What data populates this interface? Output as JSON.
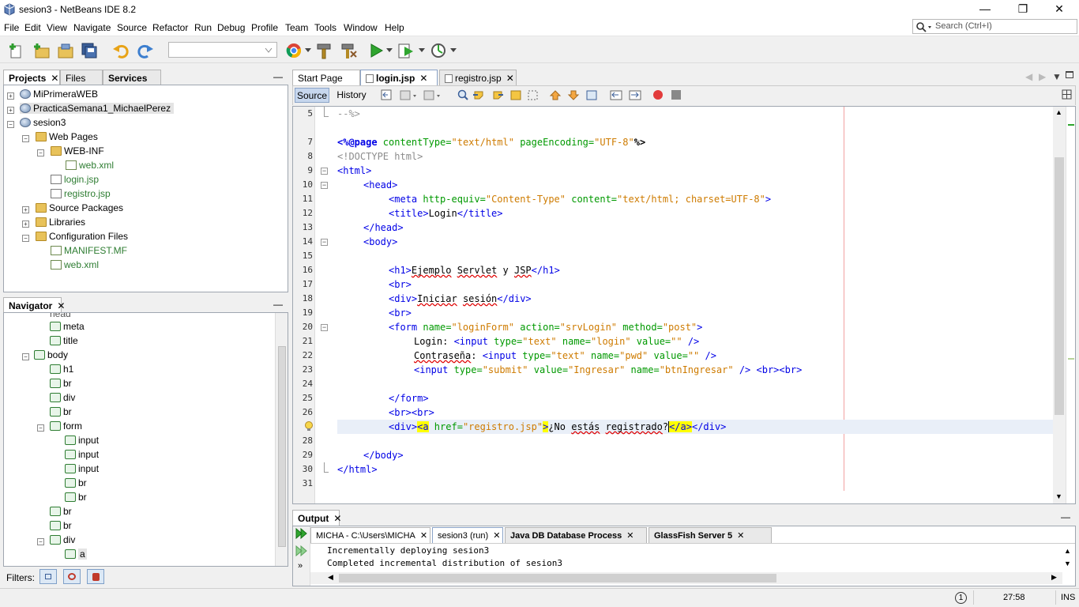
{
  "window": {
    "title": "sesion3 - NetBeans IDE 8.2",
    "minimize": "—",
    "maximize": "❐",
    "close": "✕"
  },
  "menu": [
    "File",
    "Edit",
    "View",
    "Navigate",
    "Source",
    "Refactor",
    "Run",
    "Debug",
    "Profile",
    "Team",
    "Tools",
    "Window",
    "Help"
  ],
  "search": {
    "placeholder": "Search (Ctrl+I)"
  },
  "projects_panel": {
    "tabs": [
      "Projects",
      "Files",
      "Services"
    ],
    "minimize": "—",
    "tree": [
      {
        "label": "MiPrimeraWEB",
        "icon": "globe-icon"
      },
      {
        "label": "PracticaSemana1_MichaelPerez",
        "icon": "globe-icon"
      },
      {
        "label": "sesion3",
        "icon": "globe-icon"
      },
      {
        "label": "Web Pages",
        "icon": "folder-icon"
      },
      {
        "label": "WEB-INF",
        "icon": "folder-icon"
      },
      {
        "label": "web.xml",
        "icon": "xml-file-icon"
      },
      {
        "label": "login.jsp",
        "icon": "jsp-file-icon"
      },
      {
        "label": "registro.jsp",
        "icon": "jsp-file-icon"
      },
      {
        "label": "Source Packages",
        "icon": "folder-icon"
      },
      {
        "label": "Libraries",
        "icon": "folder-icon"
      },
      {
        "label": "Configuration Files",
        "icon": "folder-icon"
      },
      {
        "label": "MANIFEST.MF",
        "icon": "manifest-file-icon"
      },
      {
        "label": "web.xml",
        "icon": "xml-file-icon"
      }
    ]
  },
  "navigator": {
    "title": "Navigator",
    "items": [
      "head",
      "meta",
      "title",
      "body",
      "h1",
      "br",
      "div",
      "br",
      "form",
      "input",
      "input",
      "input",
      "br",
      "br",
      "br",
      "br",
      "div",
      "a"
    ],
    "filters_label": "Filters:"
  },
  "editor": {
    "tabs": [
      {
        "label": "Start Page"
      },
      {
        "label": "login.jsp"
      },
      {
        "label": "registro.jsp"
      }
    ],
    "source_label": "Source",
    "history_label": "History",
    "line_numbers": [
      "5",
      "7",
      "8",
      "9",
      "10",
      "11",
      "12",
      "13",
      "14",
      "15",
      "16",
      "17",
      "18",
      "19",
      "20",
      "21",
      "22",
      "23",
      "24",
      "25",
      "26",
      "27",
      "28",
      "29",
      "30",
      "31"
    ],
    "lines": {
      "l5": "--%>",
      "l7a": "<%@page ",
      "l7b": "contentType=",
      "l7c": "\"text/html\"",
      "l7d": " pageEncoding=",
      "l7e": "\"UTF-8\"",
      "l7f": "%>",
      "l8": "<!DOCTYPE html>",
      "l9": "<html>",
      "l10": "<head>",
      "l11a": "<meta ",
      "l11b": "http-equiv=",
      "l11c": "\"Content-Type\"",
      "l11d": " content=",
      "l11e": "\"text/html; charset=UTF-8\"",
      "l11f": ">",
      "l12a": "<title>",
      "l12b": "Login",
      "l12c": "</title>",
      "l13": "</head>",
      "l14": "<body>",
      "l16a": "<h1>",
      "l16b": "Ejemplo",
      "l16c": " ",
      "l16d": "Servlet",
      "l16e": " y ",
      "l16f": "JSP",
      "l16g": "</h1>",
      "l17": "<br>",
      "l18a": "<div>",
      "l18b": "Iniciar",
      "l18c": " ",
      "l18d": "sesión",
      "l18e": "</div>",
      "l19": "<br>",
      "l20a": "<form ",
      "l20b": "name=",
      "l20c": "\"loginForm\"",
      "l20d": " action=",
      "l20e": "\"srvLogin\"",
      "l20f": " method=",
      "l20g": "\"post\"",
      "l20h": ">",
      "l21a": "Login: ",
      "l21b": "<input ",
      "l21c": "type=",
      "l21d": "\"text\"",
      "l21e": " name=",
      "l21f": "\"login\"",
      "l21g": " value=",
      "l21h": "\"\"",
      "l21i": " />",
      "l22a": "Contraseña",
      "l22b": ": ",
      "l22c": "<input ",
      "l22d": "type=",
      "l22e": "\"text\"",
      "l22f": " name=",
      "l22g": "\"pwd\"",
      "l22h": " value=",
      "l22i": "\"\"",
      "l22j": " />",
      "l23a": "<input ",
      "l23b": "type=",
      "l23c": "\"submit\"",
      "l23d": " value=",
      "l23e": "\"Ingresar\"",
      "l23f": " name=",
      "l23g": "\"btnIngresar\"",
      "l23h": " /> <br><br>",
      "l25": "</form>",
      "l26": "<br><br>",
      "l27a": "<div>",
      "l27b": "<a",
      "l27c": " href=",
      "l27d": "\"registro.jsp\"",
      "l27e": ">",
      "l27f": "¿No ",
      "l27g": "estás",
      "l27h": " ",
      "l27i": "registrado",
      "l27j": "?",
      "l27k": "</a>",
      "l27l": "</div>",
      "l29": "</body>",
      "l30": "</html>"
    }
  },
  "output": {
    "title": "Output",
    "tabs": [
      {
        "label": "MICHA - C:\\Users\\MICHA"
      },
      {
        "label": "sesion3 (run)"
      },
      {
        "label": "Java DB Database Process"
      },
      {
        "label": "GlassFish Server 5"
      }
    ],
    "lines": [
      "Incrementally deploying sesion3",
      "Completed incremental distribution of sesion3"
    ]
  },
  "status": {
    "position": "27:58",
    "mode": "INS",
    "notifications": "1"
  },
  "colors": {
    "keyword": "#0000e6",
    "attribute": "#009900",
    "string": "#ce7b00",
    "comment": "#969696",
    "highlight": "#ffff00"
  }
}
